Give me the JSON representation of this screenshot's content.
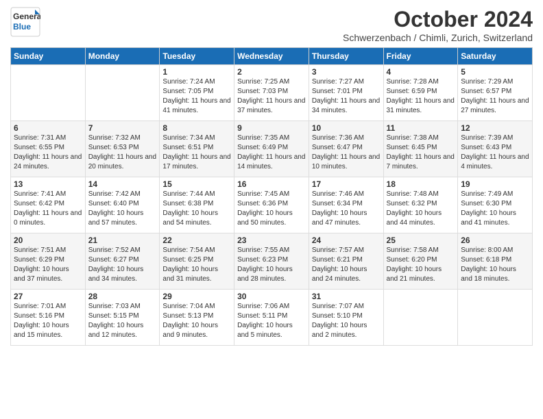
{
  "header": {
    "logo_general": "General",
    "logo_blue": "Blue",
    "month_title": "October 2024",
    "location": "Schwerzenbach / Chimli, Zurich, Switzerland"
  },
  "weekdays": [
    "Sunday",
    "Monday",
    "Tuesday",
    "Wednesday",
    "Thursday",
    "Friday",
    "Saturday"
  ],
  "weeks": [
    [
      null,
      null,
      {
        "day": "1",
        "sunrise": "7:24 AM",
        "sunset": "7:05 PM",
        "daylight": "11 hours and 41 minutes."
      },
      {
        "day": "2",
        "sunrise": "7:25 AM",
        "sunset": "7:03 PM",
        "daylight": "11 hours and 37 minutes."
      },
      {
        "day": "3",
        "sunrise": "7:27 AM",
        "sunset": "7:01 PM",
        "daylight": "11 hours and 34 minutes."
      },
      {
        "day": "4",
        "sunrise": "7:28 AM",
        "sunset": "6:59 PM",
        "daylight": "11 hours and 31 minutes."
      },
      {
        "day": "5",
        "sunrise": "7:29 AM",
        "sunset": "6:57 PM",
        "daylight": "11 hours and 27 minutes."
      }
    ],
    [
      {
        "day": "6",
        "sunrise": "7:31 AM",
        "sunset": "6:55 PM",
        "daylight": "11 hours and 24 minutes."
      },
      {
        "day": "7",
        "sunrise": "7:32 AM",
        "sunset": "6:53 PM",
        "daylight": "11 hours and 20 minutes."
      },
      {
        "day": "8",
        "sunrise": "7:34 AM",
        "sunset": "6:51 PM",
        "daylight": "11 hours and 17 minutes."
      },
      {
        "day": "9",
        "sunrise": "7:35 AM",
        "sunset": "6:49 PM",
        "daylight": "11 hours and 14 minutes."
      },
      {
        "day": "10",
        "sunrise": "7:36 AM",
        "sunset": "6:47 PM",
        "daylight": "11 hours and 10 minutes."
      },
      {
        "day": "11",
        "sunrise": "7:38 AM",
        "sunset": "6:45 PM",
        "daylight": "11 hours and 7 minutes."
      },
      {
        "day": "12",
        "sunrise": "7:39 AM",
        "sunset": "6:43 PM",
        "daylight": "11 hours and 4 minutes."
      }
    ],
    [
      {
        "day": "13",
        "sunrise": "7:41 AM",
        "sunset": "6:42 PM",
        "daylight": "11 hours and 0 minutes."
      },
      {
        "day": "14",
        "sunrise": "7:42 AM",
        "sunset": "6:40 PM",
        "daylight": "10 hours and 57 minutes."
      },
      {
        "day": "15",
        "sunrise": "7:44 AM",
        "sunset": "6:38 PM",
        "daylight": "10 hours and 54 minutes."
      },
      {
        "day": "16",
        "sunrise": "7:45 AM",
        "sunset": "6:36 PM",
        "daylight": "10 hours and 50 minutes."
      },
      {
        "day": "17",
        "sunrise": "7:46 AM",
        "sunset": "6:34 PM",
        "daylight": "10 hours and 47 minutes."
      },
      {
        "day": "18",
        "sunrise": "7:48 AM",
        "sunset": "6:32 PM",
        "daylight": "10 hours and 44 minutes."
      },
      {
        "day": "19",
        "sunrise": "7:49 AM",
        "sunset": "6:30 PM",
        "daylight": "10 hours and 41 minutes."
      }
    ],
    [
      {
        "day": "20",
        "sunrise": "7:51 AM",
        "sunset": "6:29 PM",
        "daylight": "10 hours and 37 minutes."
      },
      {
        "day": "21",
        "sunrise": "7:52 AM",
        "sunset": "6:27 PM",
        "daylight": "10 hours and 34 minutes."
      },
      {
        "day": "22",
        "sunrise": "7:54 AM",
        "sunset": "6:25 PM",
        "daylight": "10 hours and 31 minutes."
      },
      {
        "day": "23",
        "sunrise": "7:55 AM",
        "sunset": "6:23 PM",
        "daylight": "10 hours and 28 minutes."
      },
      {
        "day": "24",
        "sunrise": "7:57 AM",
        "sunset": "6:21 PM",
        "daylight": "10 hours and 24 minutes."
      },
      {
        "day": "25",
        "sunrise": "7:58 AM",
        "sunset": "6:20 PM",
        "daylight": "10 hours and 21 minutes."
      },
      {
        "day": "26",
        "sunrise": "8:00 AM",
        "sunset": "6:18 PM",
        "daylight": "10 hours and 18 minutes."
      }
    ],
    [
      {
        "day": "27",
        "sunrise": "7:01 AM",
        "sunset": "5:16 PM",
        "daylight": "10 hours and 15 minutes."
      },
      {
        "day": "28",
        "sunrise": "7:03 AM",
        "sunset": "5:15 PM",
        "daylight": "10 hours and 12 minutes."
      },
      {
        "day": "29",
        "sunrise": "7:04 AM",
        "sunset": "5:13 PM",
        "daylight": "10 hours and 9 minutes."
      },
      {
        "day": "30",
        "sunrise": "7:06 AM",
        "sunset": "5:11 PM",
        "daylight": "10 hours and 5 minutes."
      },
      {
        "day": "31",
        "sunrise": "7:07 AM",
        "sunset": "5:10 PM",
        "daylight": "10 hours and 2 minutes."
      },
      null,
      null
    ]
  ],
  "labels": {
    "sunrise": "Sunrise:",
    "sunset": "Sunset:",
    "daylight": "Daylight:"
  }
}
